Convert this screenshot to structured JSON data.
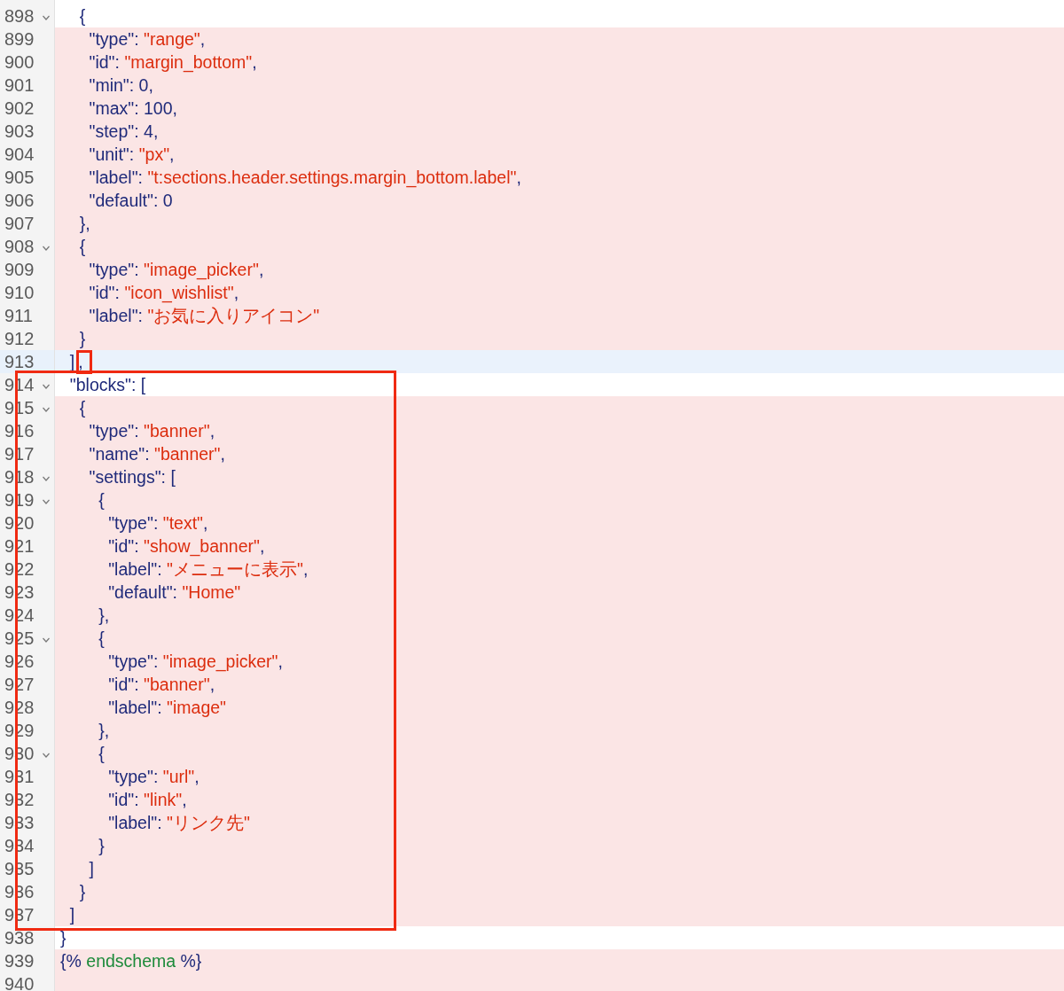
{
  "editor": {
    "lines": [
      {
        "number": "898",
        "fold": true,
        "added": false,
        "current": false,
        "tokens": [
          {
            "text": "    {",
            "kind": "plain"
          }
        ]
      },
      {
        "number": "899",
        "fold": false,
        "added": true,
        "current": false,
        "tokens": [
          {
            "text": "      \"type\": ",
            "kind": "plain"
          },
          {
            "text": "\"range\"",
            "kind": "string"
          },
          {
            "text": ",",
            "kind": "plain"
          }
        ]
      },
      {
        "number": "900",
        "fold": false,
        "added": true,
        "current": false,
        "tokens": [
          {
            "text": "      \"id\": ",
            "kind": "plain"
          },
          {
            "text": "\"margin_bottom\"",
            "kind": "string"
          },
          {
            "text": ",",
            "kind": "plain"
          }
        ]
      },
      {
        "number": "901",
        "fold": false,
        "added": true,
        "current": false,
        "tokens": [
          {
            "text": "      \"min\": 0,",
            "kind": "plain"
          }
        ]
      },
      {
        "number": "902",
        "fold": false,
        "added": true,
        "current": false,
        "tokens": [
          {
            "text": "      \"max\": 100,",
            "kind": "plain"
          }
        ]
      },
      {
        "number": "903",
        "fold": false,
        "added": true,
        "current": false,
        "tokens": [
          {
            "text": "      \"step\": 4,",
            "kind": "plain"
          }
        ]
      },
      {
        "number": "904",
        "fold": false,
        "added": true,
        "current": false,
        "tokens": [
          {
            "text": "      \"unit\": ",
            "kind": "plain"
          },
          {
            "text": "\"px\"",
            "kind": "string"
          },
          {
            "text": ",",
            "kind": "plain"
          }
        ]
      },
      {
        "number": "905",
        "fold": false,
        "added": true,
        "current": false,
        "tokens": [
          {
            "text": "      \"label\": ",
            "kind": "plain"
          },
          {
            "text": "\"t:sections.header.settings.margin_bottom.label\"",
            "kind": "string"
          },
          {
            "text": ",",
            "kind": "plain"
          }
        ]
      },
      {
        "number": "906",
        "fold": false,
        "added": true,
        "current": false,
        "tokens": [
          {
            "text": "      \"default\": 0",
            "kind": "plain"
          }
        ]
      },
      {
        "number": "907",
        "fold": false,
        "added": true,
        "current": false,
        "tokens": [
          {
            "text": "    },",
            "kind": "plain"
          }
        ]
      },
      {
        "number": "908",
        "fold": true,
        "added": true,
        "current": false,
        "tokens": [
          {
            "text": "    {",
            "kind": "plain"
          }
        ]
      },
      {
        "number": "909",
        "fold": false,
        "added": true,
        "current": false,
        "tokens": [
          {
            "text": "      \"type\": ",
            "kind": "plain"
          },
          {
            "text": "\"image_picker\"",
            "kind": "string"
          },
          {
            "text": ",",
            "kind": "plain"
          }
        ]
      },
      {
        "number": "910",
        "fold": false,
        "added": true,
        "current": false,
        "tokens": [
          {
            "text": "      \"id\": ",
            "kind": "plain"
          },
          {
            "text": "\"icon_wishlist\"",
            "kind": "string"
          },
          {
            "text": ",",
            "kind": "plain"
          }
        ]
      },
      {
        "number": "911",
        "fold": false,
        "added": true,
        "current": false,
        "tokens": [
          {
            "text": "      \"label\": ",
            "kind": "plain"
          },
          {
            "text": "\"お気に入りアイコン\"",
            "kind": "string"
          }
        ]
      },
      {
        "number": "912",
        "fold": false,
        "added": true,
        "current": false,
        "tokens": [
          {
            "text": "    }",
            "kind": "plain"
          }
        ]
      },
      {
        "number": "913",
        "fold": false,
        "added": false,
        "current": true,
        "tokens": [
          {
            "text": "  ]",
            "kind": "plain"
          },
          {
            "text": ",",
            "kind": "plain",
            "marked": true
          }
        ]
      },
      {
        "number": "914",
        "fold": true,
        "added": false,
        "current": false,
        "boxed": true,
        "tokens": [
          {
            "text": "  \"blocks\": [",
            "kind": "plain"
          }
        ]
      },
      {
        "number": "915",
        "fold": true,
        "added": true,
        "current": false,
        "boxed": true,
        "tokens": [
          {
            "text": "    {",
            "kind": "plain"
          }
        ]
      },
      {
        "number": "916",
        "fold": false,
        "added": true,
        "current": false,
        "boxed": true,
        "tokens": [
          {
            "text": "      \"type\": ",
            "kind": "plain"
          },
          {
            "text": "\"banner\"",
            "kind": "string"
          },
          {
            "text": ",",
            "kind": "plain"
          }
        ]
      },
      {
        "number": "917",
        "fold": false,
        "added": true,
        "current": false,
        "boxed": true,
        "tokens": [
          {
            "text": "      \"name\": ",
            "kind": "plain"
          },
          {
            "text": "\"banner\"",
            "kind": "string"
          },
          {
            "text": ",",
            "kind": "plain"
          }
        ]
      },
      {
        "number": "918",
        "fold": true,
        "added": true,
        "current": false,
        "boxed": true,
        "tokens": [
          {
            "text": "      \"settings\": [",
            "kind": "plain"
          }
        ]
      },
      {
        "number": "919",
        "fold": true,
        "added": true,
        "current": false,
        "boxed": true,
        "tokens": [
          {
            "text": "        {",
            "kind": "plain"
          }
        ]
      },
      {
        "number": "920",
        "fold": false,
        "added": true,
        "current": false,
        "boxed": true,
        "tokens": [
          {
            "text": "          \"type\": ",
            "kind": "plain"
          },
          {
            "text": "\"text\"",
            "kind": "string"
          },
          {
            "text": ",",
            "kind": "plain"
          }
        ]
      },
      {
        "number": "921",
        "fold": false,
        "added": true,
        "current": false,
        "boxed": true,
        "tokens": [
          {
            "text": "          \"id\": ",
            "kind": "plain"
          },
          {
            "text": "\"show_banner\"",
            "kind": "string"
          },
          {
            "text": ",",
            "kind": "plain"
          }
        ]
      },
      {
        "number": "922",
        "fold": false,
        "added": true,
        "current": false,
        "boxed": true,
        "tokens": [
          {
            "text": "          \"label\": ",
            "kind": "plain"
          },
          {
            "text": "\"メニューに表示\"",
            "kind": "string"
          },
          {
            "text": ",",
            "kind": "plain"
          }
        ]
      },
      {
        "number": "923",
        "fold": false,
        "added": true,
        "current": false,
        "boxed": true,
        "tokens": [
          {
            "text": "          \"default\": ",
            "kind": "plain"
          },
          {
            "text": "\"Home\"",
            "kind": "string"
          }
        ]
      },
      {
        "number": "924",
        "fold": false,
        "added": true,
        "current": false,
        "boxed": true,
        "tokens": [
          {
            "text": "        },",
            "kind": "plain"
          }
        ]
      },
      {
        "number": "925",
        "fold": true,
        "added": true,
        "current": false,
        "boxed": true,
        "tokens": [
          {
            "text": "        {",
            "kind": "plain"
          }
        ]
      },
      {
        "number": "926",
        "fold": false,
        "added": true,
        "current": false,
        "boxed": true,
        "tokens": [
          {
            "text": "          \"type\": ",
            "kind": "plain"
          },
          {
            "text": "\"image_picker\"",
            "kind": "string"
          },
          {
            "text": ",",
            "kind": "plain"
          }
        ]
      },
      {
        "number": "927",
        "fold": false,
        "added": true,
        "current": false,
        "boxed": true,
        "tokens": [
          {
            "text": "          \"id\": ",
            "kind": "plain"
          },
          {
            "text": "\"banner\"",
            "kind": "string"
          },
          {
            "text": ",",
            "kind": "plain"
          }
        ]
      },
      {
        "number": "928",
        "fold": false,
        "added": true,
        "current": false,
        "boxed": true,
        "tokens": [
          {
            "text": "          \"label\": ",
            "kind": "plain"
          },
          {
            "text": "\"image\"",
            "kind": "string"
          }
        ]
      },
      {
        "number": "929",
        "fold": false,
        "added": true,
        "current": false,
        "boxed": true,
        "tokens": [
          {
            "text": "        },",
            "kind": "plain"
          }
        ]
      },
      {
        "number": "930",
        "fold": true,
        "added": true,
        "current": false,
        "boxed": true,
        "tokens": [
          {
            "text": "        {",
            "kind": "plain"
          }
        ]
      },
      {
        "number": "931",
        "fold": false,
        "added": true,
        "current": false,
        "boxed": true,
        "tokens": [
          {
            "text": "          \"type\": ",
            "kind": "plain"
          },
          {
            "text": "\"url\"",
            "kind": "string"
          },
          {
            "text": ",",
            "kind": "plain"
          }
        ]
      },
      {
        "number": "932",
        "fold": false,
        "added": true,
        "current": false,
        "boxed": true,
        "tokens": [
          {
            "text": "          \"id\": ",
            "kind": "plain"
          },
          {
            "text": "\"link\"",
            "kind": "string"
          },
          {
            "text": ",",
            "kind": "plain"
          }
        ]
      },
      {
        "number": "933",
        "fold": false,
        "added": true,
        "current": false,
        "boxed": true,
        "tokens": [
          {
            "text": "          \"label\": ",
            "kind": "plain"
          },
          {
            "text": "\"リンク先\"",
            "kind": "string"
          }
        ]
      },
      {
        "number": "934",
        "fold": false,
        "added": true,
        "current": false,
        "boxed": true,
        "tokens": [
          {
            "text": "        }",
            "kind": "plain"
          }
        ]
      },
      {
        "number": "935",
        "fold": false,
        "added": true,
        "current": false,
        "boxed": true,
        "tokens": [
          {
            "text": "      ]",
            "kind": "plain"
          }
        ]
      },
      {
        "number": "936",
        "fold": false,
        "added": true,
        "current": false,
        "boxed": true,
        "tokens": [
          {
            "text": "    }",
            "kind": "plain"
          }
        ]
      },
      {
        "number": "937",
        "fold": false,
        "added": true,
        "current": false,
        "boxed": true,
        "tokens": [
          {
            "text": "  ]",
            "kind": "plain"
          }
        ]
      },
      {
        "number": "938",
        "fold": false,
        "added": false,
        "current": false,
        "tokens": [
          {
            "text": "}",
            "kind": "plain"
          }
        ]
      },
      {
        "number": "939",
        "fold": false,
        "added": true,
        "current": false,
        "tokens": [
          {
            "text": "{% ",
            "kind": "plain"
          },
          {
            "text": "endschema",
            "kind": "tag"
          },
          {
            "text": " %}",
            "kind": "plain"
          }
        ]
      },
      {
        "number": "940",
        "fold": false,
        "added": true,
        "current": false
      }
    ]
  }
}
